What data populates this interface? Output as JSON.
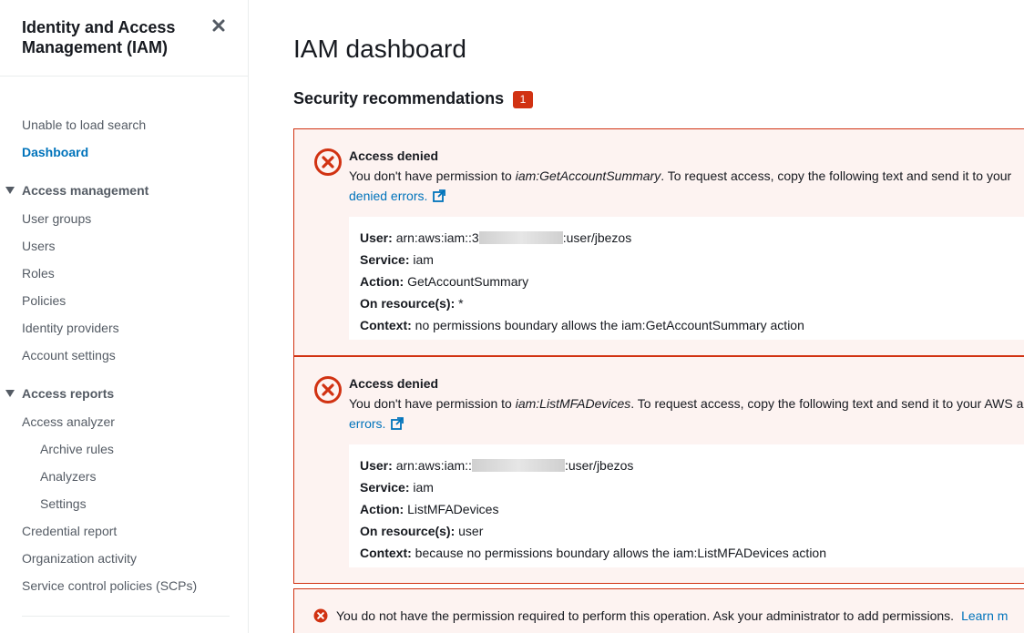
{
  "sidebar": {
    "title": "Identity and Access Management (IAM)",
    "close_icon": "close-icon",
    "search_status": "Unable to load search",
    "dashboard": "Dashboard",
    "access_management": {
      "label": "Access management",
      "items": [
        "User groups",
        "Users",
        "Roles",
        "Policies",
        "Identity providers",
        "Account settings"
      ]
    },
    "access_reports": {
      "label": "Access reports",
      "analyzer": "Access analyzer",
      "analyzer_sub": [
        "Archive rules",
        "Analyzers",
        "Settings"
      ],
      "items": [
        "Credential report",
        "Organization activity",
        "Service control policies (SCPs)"
      ]
    }
  },
  "main": {
    "title": "IAM dashboard",
    "security": {
      "title": "Security recommendations",
      "count": "1"
    },
    "alerts": [
      {
        "title": "Access denied",
        "text_prefix": "You don't have permission to ",
        "permission": "iam:GetAccountSummary",
        "text_suffix": ". To request access, copy the following text and send it to your",
        "link": "denied errors.",
        "details": {
          "user_label": "User:",
          "user_prefix": "arn:aws:iam::3",
          "user_suffix": ":user/jbezos",
          "service_label": "Service:",
          "service": "iam",
          "action_label": "Action:",
          "action": "GetAccountSummary",
          "resource_label": "On resource(s):",
          "resource": "*",
          "context_label": "Context:",
          "context": "no permissions boundary allows the iam:GetAccountSummary action"
        }
      },
      {
        "title": "Access denied",
        "text_prefix": "You don't have permission to ",
        "permission": "iam:ListMFADevices",
        "text_suffix": ". To request access, copy the following text and send it to your AWS a",
        "link": "errors.",
        "details": {
          "user_label": "User:",
          "user_prefix": "arn:aws:iam::",
          "user_suffix": ":user/jbezos",
          "service_label": "Service:",
          "service": "iam",
          "action_label": "Action:",
          "action": "ListMFADevices",
          "resource_label": "On resource(s):",
          "resource": "user",
          "context_label": "Context:",
          "context": "because no permissions boundary allows the iam:ListMFADevices action"
        }
      }
    ],
    "permission_error": {
      "text": "You do not have the permission required to perform this operation. Ask your administrator to add permissions.",
      "link": "Learn m"
    }
  },
  "colors": {
    "error": "#d13212",
    "link": "#0073bb",
    "alert_bg": "#fdf3f1"
  }
}
